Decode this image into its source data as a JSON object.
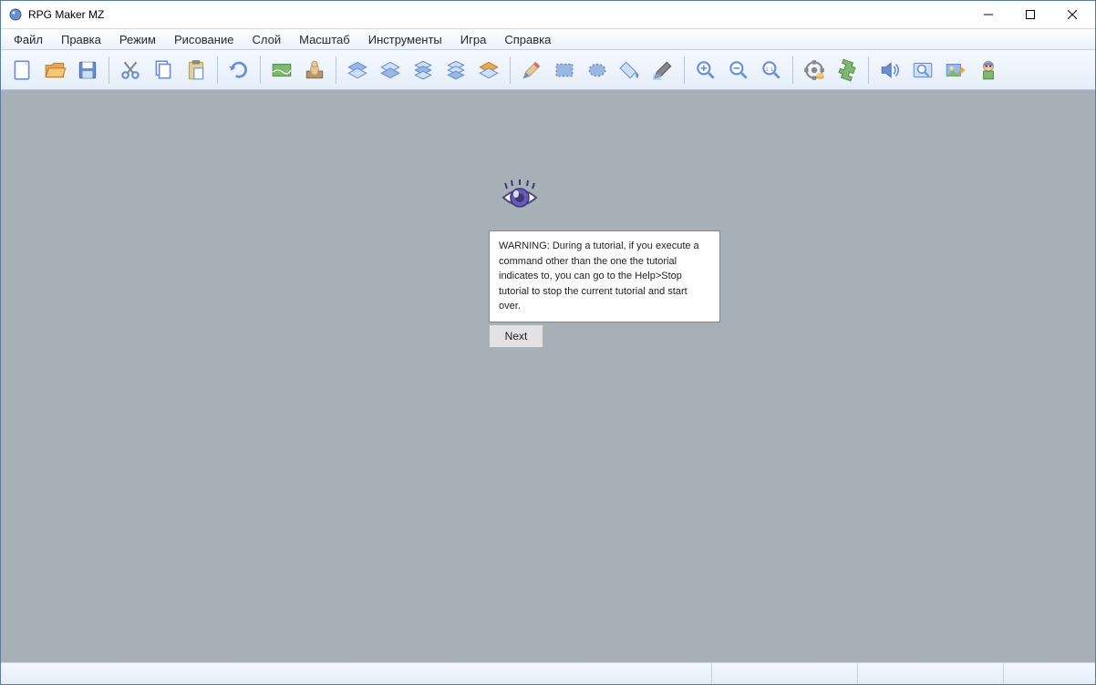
{
  "window": {
    "title": "RPG Maker MZ"
  },
  "menu": {
    "file": "Файл",
    "edit": "Правка",
    "mode": "Режим",
    "draw": "Рисование",
    "layer": "Слой",
    "scale": "Масштаб",
    "tools": "Инструменты",
    "game": "Игра",
    "help": "Справка"
  },
  "toolbar": {
    "new": "new-project",
    "open": "open-project",
    "save": "save-project",
    "cut": "cut",
    "copy": "copy",
    "paste": "paste",
    "undo": "undo",
    "map_mode": "map-mode",
    "event_mode": "event-mode",
    "l1": "layer-1",
    "l2": "layer-2",
    "l3": "layer-3",
    "l4": "layer-4",
    "region": "region-layer",
    "pencil": "pencil",
    "rect": "rectangle",
    "ellipse": "ellipse",
    "fill": "flood-fill",
    "shadow": "shadow-pen",
    "zoom_in": "zoom-in",
    "zoom_out": "zoom-out",
    "zoom_actual": "actual-size",
    "database": "database",
    "plugin": "plugin-manager",
    "sound": "sound-test",
    "search": "event-searcher",
    "res_mgr": "resource-manager",
    "char_gen": "character-generator"
  },
  "tutorial": {
    "text": "WARNING: During a tutorial, if you execute a command other than the one the tutorial indicates to, you can go to the Help>Stop tutorial to stop the current tutorial and start over.",
    "next_label": "Next"
  },
  "colors": {
    "icon_blue": "#6a8fd4",
    "icon_blue_dark": "#4a6db0",
    "icon_orange": "#e8a850",
    "icon_green": "#7fb871",
    "icon_purple": "#8878d0"
  }
}
